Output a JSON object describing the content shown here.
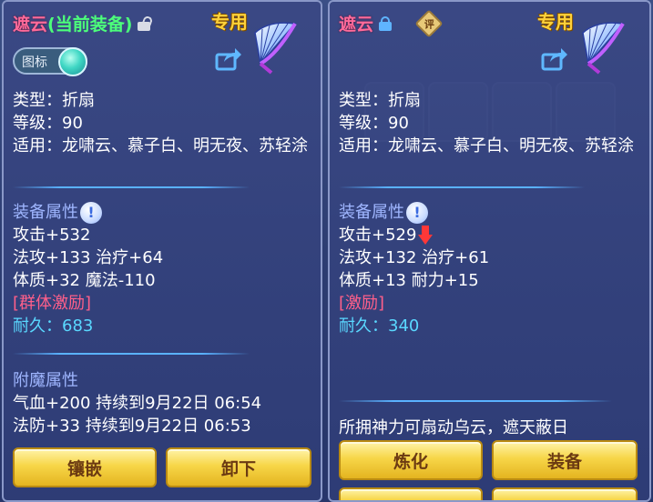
{
  "left_panel": {
    "item_name": "遮云",
    "status": "(当前装备)",
    "exclusive_tag": "专用",
    "toggle_label": "图标",
    "type_line": "类型：折扇",
    "level_line": "等级：90",
    "usage_line": "适用：龙啸云、慕子白、明无夜、苏轻涂",
    "attr_section": "装备属性",
    "attr_lines": [
      "攻击+532",
      "法攻+133 治疗+64",
      "体质+32 魔法-110"
    ],
    "bonus": "[群体激励]",
    "durability_label": "耐久：",
    "durability_value": "683",
    "enchant_section": "附魔属性",
    "enchant_lines": [
      "气血+200 持续到9月22日 06:54",
      "法防+33 持续到9月22日 06:53"
    ],
    "buttons": [
      "镶嵌",
      "卸下"
    ]
  },
  "right_panel": {
    "item_name": "遮云",
    "eval_badge": "评",
    "exclusive_tag": "专用",
    "type_line": "类型：折扇",
    "level_line": "等级：90",
    "usage_line": "适用：龙啸云、慕子白、明无夜、苏轻涂",
    "attr_section": "装备属性",
    "attr_lines": [
      "攻击+529",
      "法攻+132 治疗+61",
      "体质+13 耐力+15"
    ],
    "bonus": "[激励]",
    "durability_label": "耐久：",
    "durability_value": "340",
    "description": "所拥神力可扇动乌云，遮天蔽日",
    "buttons": [
      "炼化",
      "装备"
    ]
  },
  "icons": {
    "fan": "folding-fan-icon",
    "share": "share-icon",
    "lock": "lock-icon",
    "info": "exclamation-icon",
    "down_arrow": "down-arrow-icon"
  },
  "colors": {
    "item_name": "#ff6a9a",
    "current_equipped": "#4cff7a",
    "exclusive": "#ffd23a",
    "section": "#9fb6ff",
    "bonus": "#ff5f8a",
    "durability": "#5ad8ff",
    "button": "#f7d648"
  }
}
